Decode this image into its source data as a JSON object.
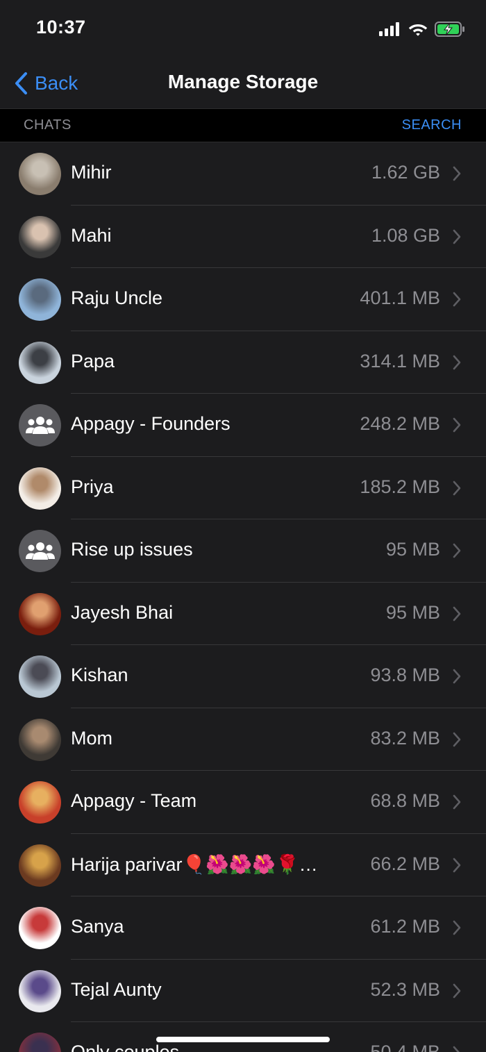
{
  "status_bar": {
    "time": "10:37"
  },
  "nav": {
    "back_label": "Back",
    "title": "Manage Storage"
  },
  "section": {
    "title": "CHATS",
    "action": "SEARCH"
  },
  "chats": [
    {
      "name": "Mihir",
      "size": "1.62 GB",
      "avatar": "photo",
      "colors": [
        "#8a7d6e",
        "#c8c0b4"
      ]
    },
    {
      "name": "Mahi",
      "size": "1.08 GB",
      "avatar": "photo",
      "colors": [
        "#3a3a3a",
        "#d9c2b0"
      ]
    },
    {
      "name": "Raju Uncle",
      "size": "401.1 MB",
      "avatar": "photo",
      "colors": [
        "#8fb4d9",
        "#5a6a7e"
      ]
    },
    {
      "name": "Papa",
      "size": "314.1 MB",
      "avatar": "photo",
      "colors": [
        "#c9d3dd",
        "#3c3f45"
      ]
    },
    {
      "name": "Appagy - Founders",
      "size": "248.2 MB",
      "avatar": "group"
    },
    {
      "name": "Priya",
      "size": "185.2 MB",
      "avatar": "photo",
      "colors": [
        "#f3ede6",
        "#b08a6a"
      ]
    },
    {
      "name": "Rise up issues",
      "size": "95 MB",
      "avatar": "group"
    },
    {
      "name": "Jayesh Bhai",
      "size": "95 MB",
      "avatar": "photo",
      "colors": [
        "#7a1e0e",
        "#e0a070"
      ]
    },
    {
      "name": "Kishan",
      "size": "93.8 MB",
      "avatar": "photo",
      "colors": [
        "#b9c7d3",
        "#4b4b55"
      ]
    },
    {
      "name": "Mom",
      "size": "83.2 MB",
      "avatar": "photo",
      "colors": [
        "#3f3a35",
        "#a88a70"
      ]
    },
    {
      "name": "Appagy - Team",
      "size": "68.8 MB",
      "avatar": "photo",
      "colors": [
        "#c8402a",
        "#e7b060"
      ]
    },
    {
      "name": "Harija parivar🎈🌺🌺🌺🌹…",
      "size": "66.2 MB",
      "avatar": "photo",
      "colors": [
        "#6b3a20",
        "#d7a24a"
      ]
    },
    {
      "name": "Sanya",
      "size": "61.2 MB",
      "avatar": "photo",
      "colors": [
        "#ffffff",
        "#c73a3a"
      ]
    },
    {
      "name": "Tejal Aunty",
      "size": "52.3 MB",
      "avatar": "photo",
      "colors": [
        "#e9e9ee",
        "#5a4a8a"
      ]
    },
    {
      "name": "Only couples",
      "size": "50.4 MB",
      "avatar": "photo",
      "colors": [
        "#7a3040",
        "#3a3050"
      ]
    }
  ],
  "colors": {
    "accent": "#3b8ef5",
    "background": "#1c1c1e",
    "secondary_text": "#8e8e93",
    "battery_charging": "#30d158"
  }
}
